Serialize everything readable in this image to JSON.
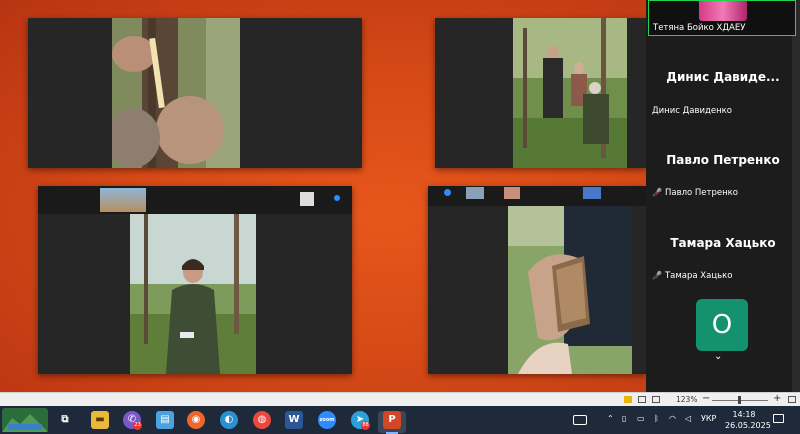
{
  "panel": {
    "self_name": "Тетяна Бойко ХДАЕУ",
    "participants": [
      {
        "big_name": "Динис Давиде...",
        "small_name": "Динис Давиденко",
        "muted": false
      },
      {
        "big_name": "Павло Петренко",
        "small_name": "Павло Петренко",
        "muted": true
      },
      {
        "big_name": "Тамара Хацько",
        "small_name": "Тамара Хацько",
        "muted": true
      }
    ],
    "tile_initial": "О",
    "scroll_glyph": "⌄"
  },
  "statusbar": {
    "zoom": "123%",
    "zoom_minus": "−",
    "zoom_plus": "+"
  },
  "taskbar": {
    "icons": [
      {
        "name": "task-view-icon",
        "glyph": "⧉",
        "color": "#1e2a3a"
      },
      {
        "name": "file-explorer-icon",
        "glyph": "▬",
        "color": "#e8b93a"
      },
      {
        "name": "viber-icon",
        "glyph": "✆",
        "color": "#7b57c9"
      },
      {
        "name": "folder-sync-icon",
        "glyph": "▤",
        "color": "#4aa3df"
      },
      {
        "name": "firefox-icon",
        "glyph": "◉",
        "color": "#f0662a"
      },
      {
        "name": "edge-icon",
        "glyph": "◐",
        "color": "#2b8fd6"
      },
      {
        "name": "chrome-icon",
        "glyph": "◍",
        "color": "#e9483b"
      },
      {
        "name": "word-icon",
        "glyph": "W",
        "color": "#2b5797"
      },
      {
        "name": "zoom-icon",
        "glyph": "zoom",
        "color": "#2d8cff"
      },
      {
        "name": "telegram-icon",
        "glyph": "➤",
        "color": "#2aa1da"
      },
      {
        "name": "powerpoint-icon",
        "glyph": "P",
        "color": "#d24726"
      }
    ],
    "badges": {
      "viber": "23",
      "telegram": "88"
    },
    "keyboard_layout": "УКР",
    "time": "14:18",
    "date": "26.05.2025"
  }
}
